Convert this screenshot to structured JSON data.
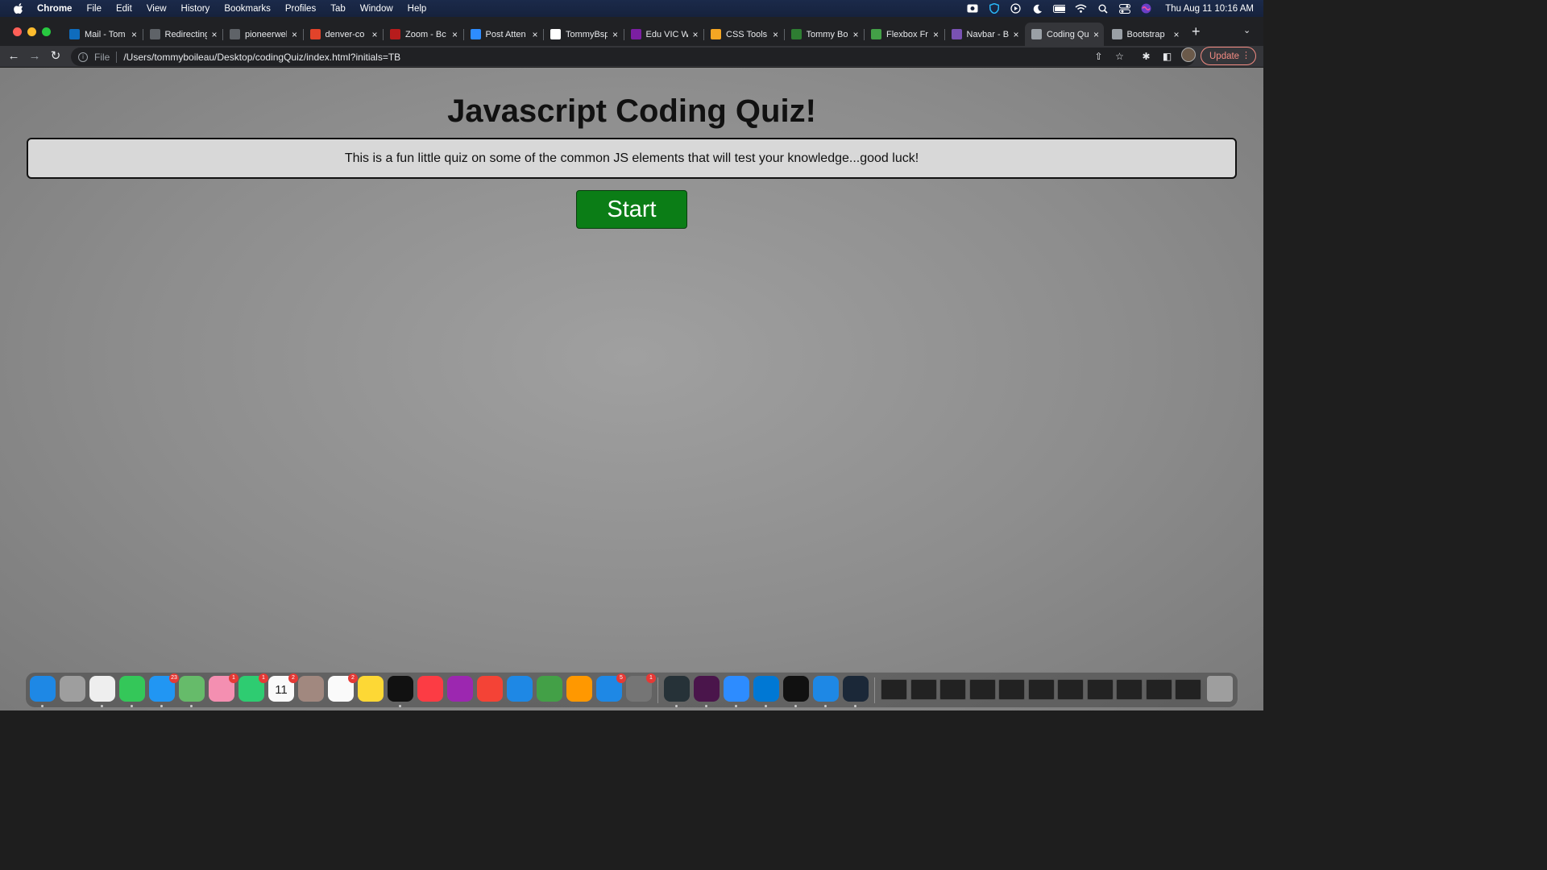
{
  "menubar": {
    "app_name": "Chrome",
    "items": [
      "File",
      "Edit",
      "View",
      "History",
      "Bookmarks",
      "Profiles",
      "Tab",
      "Window",
      "Help"
    ],
    "clock": "Thu Aug 11  10:16 AM"
  },
  "tabs": [
    {
      "title": "Mail - Tom",
      "icon": "outlook-icon",
      "color": "#0f6cbd"
    },
    {
      "title": "Redirecting",
      "icon": "globe-icon",
      "color": "#5f6368"
    },
    {
      "title": "pioneerweb",
      "icon": "globe-icon",
      "color": "#5f6368"
    },
    {
      "title": "denver-co",
      "icon": "gitlab-icon",
      "color": "#e2432a"
    },
    {
      "title": "Zoom - Bc",
      "icon": "shield-icon",
      "color": "#b71c1c"
    },
    {
      "title": "Post Atten",
      "icon": "zoom-icon",
      "color": "#2d8cff"
    },
    {
      "title": "TommyBsp",
      "icon": "github-icon",
      "color": "#ffffff"
    },
    {
      "title": "Edu VIC W",
      "icon": "edu-icon",
      "color": "#7b1fa2"
    },
    {
      "title": "CSS Tools",
      "icon": "css-tools-icon",
      "color": "#f5a623"
    },
    {
      "title": "Tommy Bo",
      "icon": "tb-icon",
      "color": "#2e7d32"
    },
    {
      "title": "Flexbox Fr",
      "icon": "frog-icon",
      "color": "#43a047"
    },
    {
      "title": "Navbar - B",
      "icon": "bootstrap-icon",
      "color": "#7952b3"
    },
    {
      "title": "Coding Qu",
      "icon": "globe-icon",
      "color": "#9aa0a6",
      "active": true
    },
    {
      "title": "Bootstrap",
      "icon": "globe-icon",
      "color": "#9aa0a6"
    }
  ],
  "toolbar": {
    "scheme": "File",
    "url": "/Users/tommyboileau/Desktop/codingQuiz/index.html?initials=TB",
    "update_label": "Update"
  },
  "page": {
    "title": "Javascript Coding Quiz!",
    "intro": "This is a fun little quiz on some of the common JS elements that will test your knowledge...good luck!",
    "start_label": "Start"
  },
  "dock": {
    "apps": [
      {
        "name": "finder",
        "color": "#1e88e5",
        "running": true
      },
      {
        "name": "launchpad",
        "color": "#9e9e9e"
      },
      {
        "name": "chrome",
        "color": "#eeeeee",
        "running": true
      },
      {
        "name": "messages",
        "color": "#34c759",
        "running": true
      },
      {
        "name": "mail",
        "color": "#2196f3",
        "badge": "23",
        "running": true
      },
      {
        "name": "maps",
        "color": "#66bb6a",
        "running": true
      },
      {
        "name": "photos",
        "color": "#f48fb1",
        "badge": "1"
      },
      {
        "name": "facetime",
        "color": "#2ecc71",
        "badge": "1"
      },
      {
        "name": "calendar",
        "color": "#fafafa",
        "badge": "2",
        "label": "11"
      },
      {
        "name": "contacts",
        "color": "#a1887f"
      },
      {
        "name": "reminders",
        "color": "#fafafa",
        "badge": "2"
      },
      {
        "name": "notes",
        "color": "#fdd835"
      },
      {
        "name": "apple-tv",
        "color": "#111111",
        "running": true
      },
      {
        "name": "music",
        "color": "#fc3c44"
      },
      {
        "name": "podcasts",
        "color": "#9c27b0"
      },
      {
        "name": "news",
        "color": "#f44336"
      },
      {
        "name": "keynote",
        "color": "#1e88e5"
      },
      {
        "name": "numbers",
        "color": "#43a047"
      },
      {
        "name": "pages",
        "color": "#ff9800"
      },
      {
        "name": "app-store",
        "color": "#1e88e5",
        "badge": "5"
      },
      {
        "name": "system-preferences",
        "color": "#757575",
        "badge": "1"
      },
      {
        "name": "activity-monitor",
        "color": "#263238",
        "running": true
      },
      {
        "name": "slack",
        "color": "#4a154b",
        "running": true
      },
      {
        "name": "zoom",
        "color": "#2d8cff",
        "running": true
      },
      {
        "name": "vscode",
        "color": "#0078d4",
        "running": true
      },
      {
        "name": "terminal",
        "color": "#111111",
        "running": true
      },
      {
        "name": "safari",
        "color": "#1e88e5",
        "running": true
      },
      {
        "name": "steam",
        "color": "#1b2838",
        "running": true
      }
    ],
    "window_thumbnails": 11
  }
}
